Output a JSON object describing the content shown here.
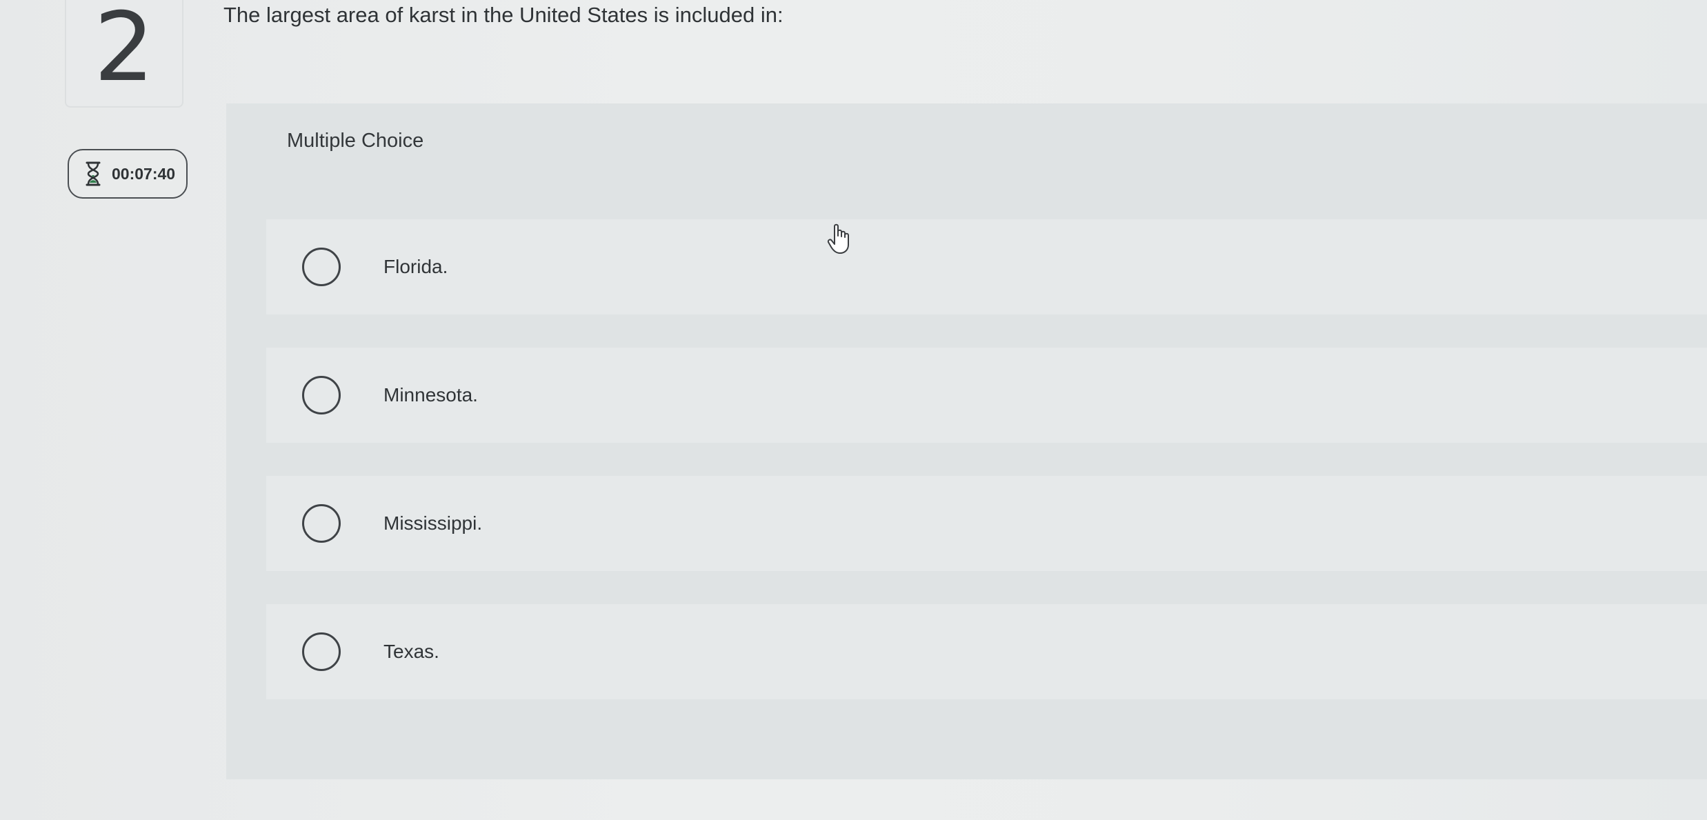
{
  "question": {
    "number": "2",
    "text": "The largest area of karst in the United States is included in:"
  },
  "timer": {
    "icon": "hourglass-icon",
    "value": "00:07:40"
  },
  "multiple_choice": {
    "title": "Multiple Choice",
    "options": [
      {
        "label": "Florida."
      },
      {
        "label": "Minnesota."
      },
      {
        "label": "Mississippi."
      },
      {
        "label": "Texas."
      }
    ]
  },
  "cursor": {
    "icon": "hand-pointer-icon"
  },
  "colors": {
    "panel": "#dfe3e4",
    "card": "#e6e9ea",
    "timer_icon_green": "#2f7d4b",
    "text": "#2f3336"
  }
}
